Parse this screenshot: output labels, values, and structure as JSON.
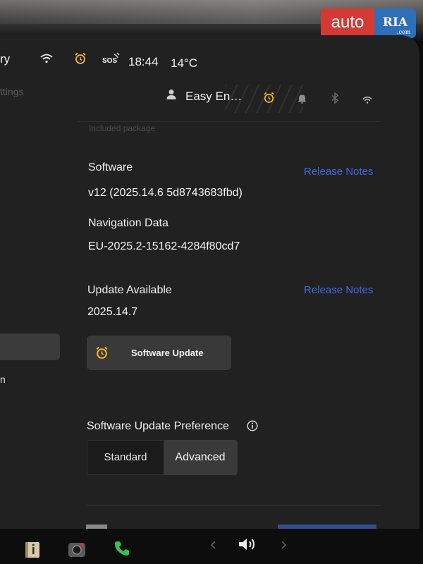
{
  "status_bar": {
    "left_fragment": "ry",
    "sos_label": "SOS",
    "time": "18:44",
    "temperature": "14°C"
  },
  "header": {
    "left_fragment": "ttings",
    "profile_name": "Easy En…"
  },
  "content": {
    "faded_text": "Included package",
    "software_label": "Software",
    "software_release_notes": "Release Notes",
    "software_version": "v12 (2025.14.6 5d8743683fbd)",
    "navigation_label": "Navigation Data",
    "navigation_version": "EU-2025.2-15162-4284f80cd7",
    "update_available_label": "Update Available",
    "update_release_notes": "Release Notes",
    "update_version": "2025.14.7",
    "software_update_button": "Software Update",
    "left_pane_fragment": "n",
    "preference_label": "Software Update Preference",
    "preference_options": [
      "Standard",
      "Advanced"
    ],
    "preference_selected": "Advanced"
  },
  "watermark": {
    "auto": "auto",
    "ria": "RIA",
    "com": ".com"
  },
  "colors": {
    "alarm_yellow": "#f5b921",
    "link_blue": "#3e6ae1",
    "call_green": "#35c24a"
  },
  "icons": [
    "wifi-icon",
    "alarm-clock-icon",
    "sos-icon",
    "person-icon",
    "bell-icon",
    "bluetooth-icon",
    "info-icon",
    "phone-icon",
    "camera-icon",
    "manual-icon",
    "volume-icon",
    "chevron-left-icon",
    "chevron-right-icon"
  ]
}
